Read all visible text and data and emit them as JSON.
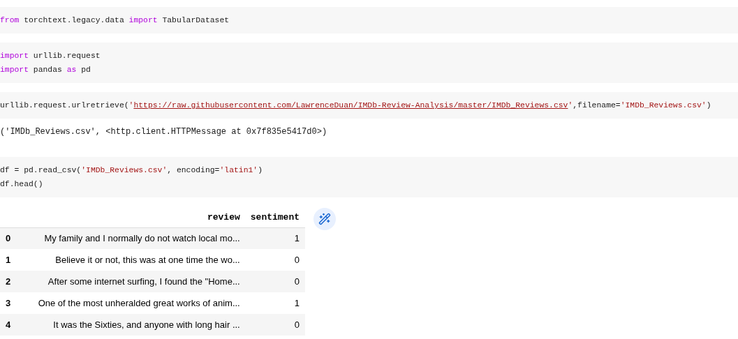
{
  "cells": [
    {
      "kind": "code",
      "lines": [
        [
          {
            "kind": "keyword",
            "text": "from"
          },
          {
            "kind": "plain",
            "text": " torchtext.legacy.data "
          },
          {
            "kind": "keyword",
            "text": "import"
          },
          {
            "kind": "plain",
            "text": " TabularDataset"
          }
        ]
      ]
    },
    {
      "kind": "code",
      "lines": [
        [
          {
            "kind": "keyword",
            "text": "import"
          },
          {
            "kind": "plain",
            "text": " urllib.request"
          }
        ],
        [
          {
            "kind": "keyword",
            "text": "import"
          },
          {
            "kind": "plain",
            "text": " pandas "
          },
          {
            "kind": "keyword",
            "text": "as"
          },
          {
            "kind": "plain",
            "text": " pd"
          }
        ]
      ]
    },
    {
      "kind": "code",
      "lines": [
        [
          {
            "kind": "plain",
            "text": "urllib.request.urlretrieve("
          },
          {
            "kind": "string",
            "text": "'"
          },
          {
            "kind": "link",
            "text": "https://raw.githubusercontent.com/LawrenceDuan/IMDb-Review-Analysis/master/IMDb_Reviews.csv"
          },
          {
            "kind": "string",
            "text": "'"
          },
          {
            "kind": "plain",
            "text": ",filename="
          },
          {
            "kind": "string",
            "text": "'IMDb_Reviews.csv'"
          },
          {
            "kind": "plain",
            "text": ")"
          }
        ]
      ]
    },
    {
      "kind": "output",
      "text": "('IMDb_Reviews.csv', <http.client.HTTPMessage at 0x7f835e5417d0>)"
    },
    {
      "kind": "code",
      "lines": [
        [
          {
            "kind": "plain",
            "text": "df = pd.read_csv("
          },
          {
            "kind": "string",
            "text": "'IMDb_Reviews.csv'"
          },
          {
            "kind": "plain",
            "text": ", encoding="
          },
          {
            "kind": "string",
            "text": "'latin1'"
          },
          {
            "kind": "plain",
            "text": ")"
          }
        ],
        [
          {
            "kind": "plain",
            "text": "df.head()"
          }
        ]
      ]
    },
    {
      "kind": "table",
      "columns": [
        "review",
        "sentiment"
      ],
      "rows": [
        {
          "index": "0",
          "cells": [
            "My family and I normally do not watch local mo...",
            "1"
          ]
        },
        {
          "index": "1",
          "cells": [
            "Believe it or not, this was at one time the wo...",
            "0"
          ]
        },
        {
          "index": "2",
          "cells": [
            "After some internet surfing, I found the \"Home...",
            "0"
          ]
        },
        {
          "index": "3",
          "cells": [
            "One of the most unheralded great works of anim...",
            "1"
          ]
        },
        {
          "index": "4",
          "cells": [
            "It was the Sixties, and anyone with long hair ...",
            "0"
          ]
        }
      ]
    }
  ]
}
